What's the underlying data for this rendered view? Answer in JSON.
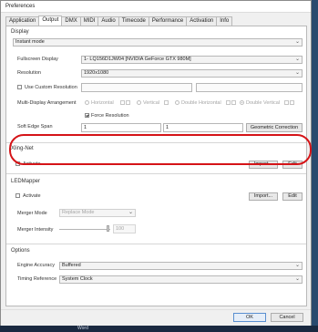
{
  "window": {
    "title": "Preferences"
  },
  "tabs": [
    {
      "label": "Application",
      "active": false
    },
    {
      "label": "Output",
      "active": true
    },
    {
      "label": "DMX",
      "active": false
    },
    {
      "label": "MIDI",
      "active": false
    },
    {
      "label": "Audio",
      "active": false
    },
    {
      "label": "Timecode",
      "active": false
    },
    {
      "label": "Performance",
      "active": false
    },
    {
      "label": "Activation",
      "active": false
    },
    {
      "label": "Info",
      "active": false
    }
  ],
  "display": {
    "section": "Display",
    "mode_value": "Instant mode",
    "fullscreen_label": "Fullscreen Display",
    "fullscreen_value": "1- LQ156D1JW04 [NVIDIA GeForce GTX 980M]",
    "resolution_label": "Resolution",
    "resolution_value": "1920x1080",
    "custom_res_label": "Use Custom Resolution",
    "arrangement_label": "Multi-Display Arrangement",
    "horizontal": "Horizontal",
    "vertical": "Vertical",
    "double_horizontal": "Double Horizontal",
    "double_vertical": "Double Vertical",
    "force_label": "Force Resolution",
    "soft_edge_label": "Soft Edge Span",
    "soft_edge_1": "1",
    "soft_edge_2": "1",
    "geometric_button": "Geometric Correction"
  },
  "xling": {
    "section": "Xling-Net",
    "activate": "Activate",
    "import": "Import...",
    "edit": "Edit"
  },
  "led": {
    "section": "LEDMapper",
    "activate": "Activate",
    "import": "Import...",
    "edit": "Edit",
    "merger_mode_label": "Merger Mode",
    "merger_mode_value": "Replace Mode",
    "merger_intensity_label": "Merger Intensity",
    "merger_intensity_value": "100"
  },
  "options": {
    "section": "Options",
    "accuracy_label": "Engine Accuracy",
    "accuracy_value": "Buffered",
    "timing_label": "Timing Reference",
    "timing_value": "System Clock"
  },
  "footer": {
    "ok": "OK",
    "cancel": "Cancel"
  },
  "taskbar": {
    "text": "Word"
  }
}
